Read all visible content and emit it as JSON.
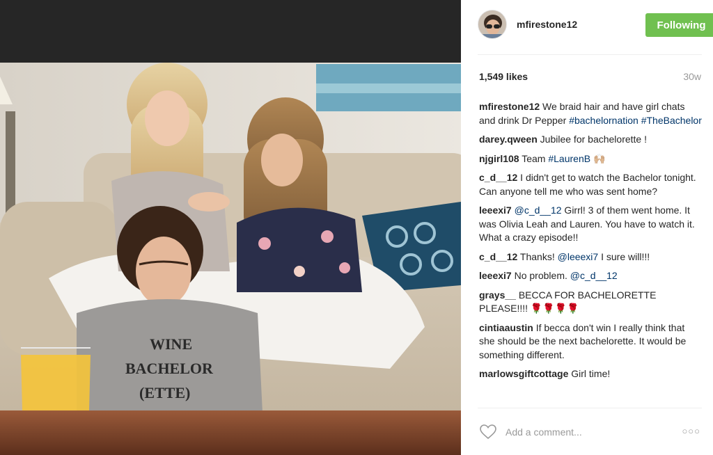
{
  "post": {
    "username": "mfirestone12",
    "follow_label": "Following",
    "likes": "1,549 likes",
    "age": "30w",
    "shirt_text": [
      "WINE",
      "BACHELOR",
      "(ETTE)"
    ]
  },
  "comments": [
    {
      "user": "mfirestone12",
      "parts": [
        {
          "t": "We braid hair and have girl chats and drink Dr Pepper "
        },
        {
          "t": "#bachelornation",
          "tag": true
        },
        {
          "t": " "
        },
        {
          "t": "#TheBachelor",
          "tag": true
        }
      ]
    },
    {
      "user": "darey.qween",
      "parts": [
        {
          "t": "Jubilee for bachelorette !"
        }
      ]
    },
    {
      "user": "njgirl108",
      "parts": [
        {
          "t": "Team "
        },
        {
          "t": "#LaurenB",
          "tag": true
        },
        {
          "t": " 🙌🏼"
        }
      ]
    },
    {
      "user": "c_d__12",
      "parts": [
        {
          "t": "I didn't get to watch the Bachelor tonight. Can anyone tell me who was sent home?"
        }
      ]
    },
    {
      "user": "leeexi7",
      "parts": [
        {
          "t": "@c_d__12",
          "tag": true
        },
        {
          "t": " Girrl! 3 of them went home. It was Olivia Leah and Lauren. You have to watch it. What a crazy episode!!"
        }
      ]
    },
    {
      "user": "c_d__12",
      "parts": [
        {
          "t": "Thanks! "
        },
        {
          "t": "@leeexi7",
          "tag": true
        },
        {
          "t": " I sure will!!!"
        }
      ]
    },
    {
      "user": "leeexi7",
      "parts": [
        {
          "t": "No problem. "
        },
        {
          "t": "@c_d__12",
          "tag": true
        }
      ]
    },
    {
      "user": "grays__",
      "parts": [
        {
          "t": "BECCA FOR BACHELORETTE PLEASE!!!! 🌹🌹🌹🌹"
        }
      ]
    },
    {
      "user": "cintiaaustin",
      "parts": [
        {
          "t": "If becca don't win I really think that she should be the next bachelorette. It would be something different."
        }
      ]
    },
    {
      "user": "marlowsgiftcottage",
      "parts": [
        {
          "t": "Girl time!"
        }
      ]
    }
  ],
  "add_comment": {
    "placeholder": "Add a comment...",
    "more_icon": "more-options-icon",
    "heart_icon": "heart-icon"
  },
  "colors": {
    "follow": "#70c050",
    "tag": "#003569",
    "muted": "#999999"
  }
}
